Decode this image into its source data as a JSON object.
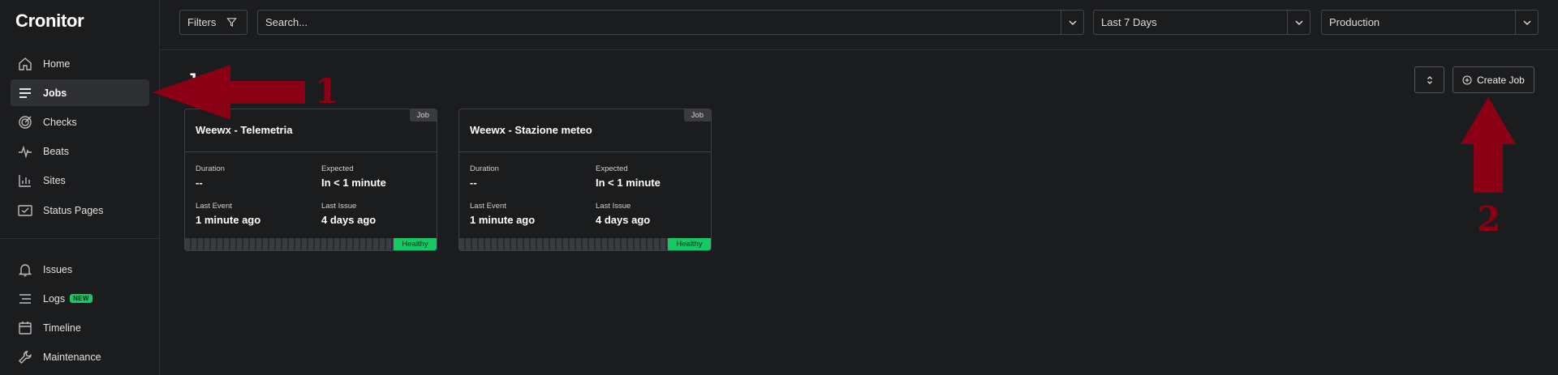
{
  "app": {
    "logo": "Cronitor"
  },
  "sidebar": {
    "primary": [
      {
        "label": "Home",
        "icon": "home-icon"
      },
      {
        "label": "Jobs",
        "icon": "jobs-list-icon",
        "active": true
      },
      {
        "label": "Checks",
        "icon": "target-icon"
      },
      {
        "label": "Beats",
        "icon": "heartbeat-icon"
      },
      {
        "label": "Sites",
        "icon": "bar-chart-icon"
      },
      {
        "label": "Status Pages",
        "icon": "status-page-icon"
      }
    ],
    "secondary": [
      {
        "label": "Issues",
        "icon": "bell-icon"
      },
      {
        "label": "Logs",
        "icon": "logs-icon",
        "badge": "NEW"
      },
      {
        "label": "Timeline",
        "icon": "calendar-icon"
      },
      {
        "label": "Maintenance",
        "icon": "wrench-icon"
      }
    ]
  },
  "topbar": {
    "filters_label": "Filters",
    "search_placeholder": "Search...",
    "time_range": "Last 7 Days",
    "environment": "Production"
  },
  "main": {
    "title": "Jobs",
    "create_button": "Create Job",
    "jobs": [
      {
        "name": "Weewx - Telemetria",
        "type": "Job",
        "duration_label": "Duration",
        "duration": "--",
        "expected_label": "Expected",
        "expected": "In < 1 minute",
        "last_event_label": "Last Event",
        "last_event": "1 minute ago",
        "last_issue_label": "Last Issue",
        "last_issue": "4 days ago",
        "status": "Healthy"
      },
      {
        "name": "Weewx - Stazione meteo",
        "type": "Job",
        "duration_label": "Duration",
        "duration": "--",
        "expected_label": "Expected",
        "expected": "In < 1 minute",
        "last_event_label": "Last Event",
        "last_event": "1 minute ago",
        "last_issue_label": "Last Issue",
        "last_issue": "4 days ago",
        "status": "Healthy"
      }
    ]
  },
  "annotations": {
    "step_1": "1",
    "step_2": "2"
  },
  "colors": {
    "background": "#1b1c1e",
    "healthy": "#17c964",
    "annotation": "#8b0015"
  }
}
